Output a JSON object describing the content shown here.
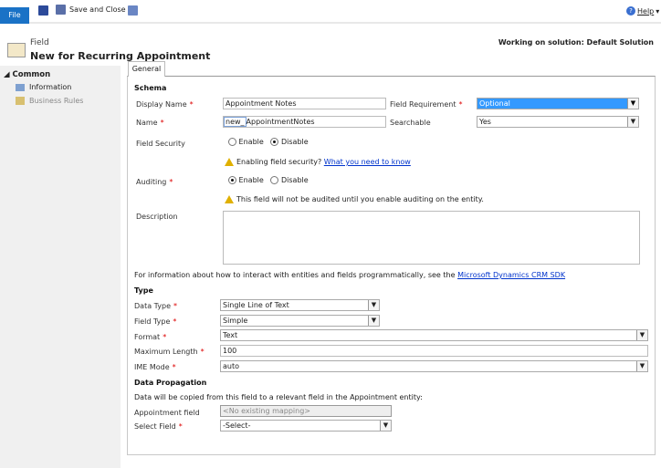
{
  "toolbar": {
    "file": "File",
    "save_and_close": "Save and Close",
    "help": "Help",
    "help_caret": "▾"
  },
  "header": {
    "entity_type": "Field",
    "title": "New for Recurring Appointment",
    "solution": "Working on solution: Default Solution"
  },
  "sidebar": {
    "section": "Common",
    "items": [
      {
        "label": "Information"
      },
      {
        "label": "Business Rules"
      }
    ]
  },
  "tabs": [
    {
      "label": "General"
    }
  ],
  "schema": {
    "heading": "Schema",
    "display_name": {
      "label": "Display Name",
      "value": "Appointment Notes"
    },
    "field_requirement": {
      "label": "Field Requirement",
      "value": "Optional"
    },
    "name": {
      "label": "Name",
      "prefix": "new_",
      "value": "AppointmentNotes"
    },
    "searchable": {
      "label": "Searchable",
      "value": "Yes"
    },
    "field_security": {
      "label": "Field Security",
      "options": [
        "Enable",
        "Disable"
      ],
      "selected": "Disable"
    },
    "field_security_warning": "Enabling field security?",
    "field_security_link": "What you need to know",
    "auditing": {
      "label": "Auditing",
      "options": [
        "Enable",
        "Disable"
      ],
      "selected": "Enable"
    },
    "auditing_warning": "This field will not be audited until you enable auditing on the entity.",
    "description": {
      "label": "Description",
      "value": ""
    }
  },
  "info": {
    "text": "For information about how to interact with entities and fields programmatically, see the ",
    "link": "Microsoft Dynamics CRM SDK"
  },
  "type": {
    "heading": "Type",
    "data_type": {
      "label": "Data Type",
      "value": "Single Line of Text"
    },
    "field_type": {
      "label": "Field Type",
      "value": "Simple"
    },
    "format": {
      "label": "Format",
      "value": "Text"
    },
    "max_length": {
      "label": "Maximum Length",
      "value": "100"
    },
    "ime_mode": {
      "label": "IME Mode",
      "value": "auto"
    }
  },
  "propagation": {
    "heading": "Data Propagation",
    "text": "Data will be copied from this field to a relevant field in the Appointment entity:",
    "appointment_field": {
      "label": "Appointment field",
      "placeholder": "<No existing mapping>"
    },
    "select_field": {
      "label": "Select Field",
      "value": "-Select-"
    }
  },
  "required_mark": "*",
  "colors": {
    "accent": "#1a72c6",
    "selected": "#3399ff",
    "required": "#dd0000"
  }
}
